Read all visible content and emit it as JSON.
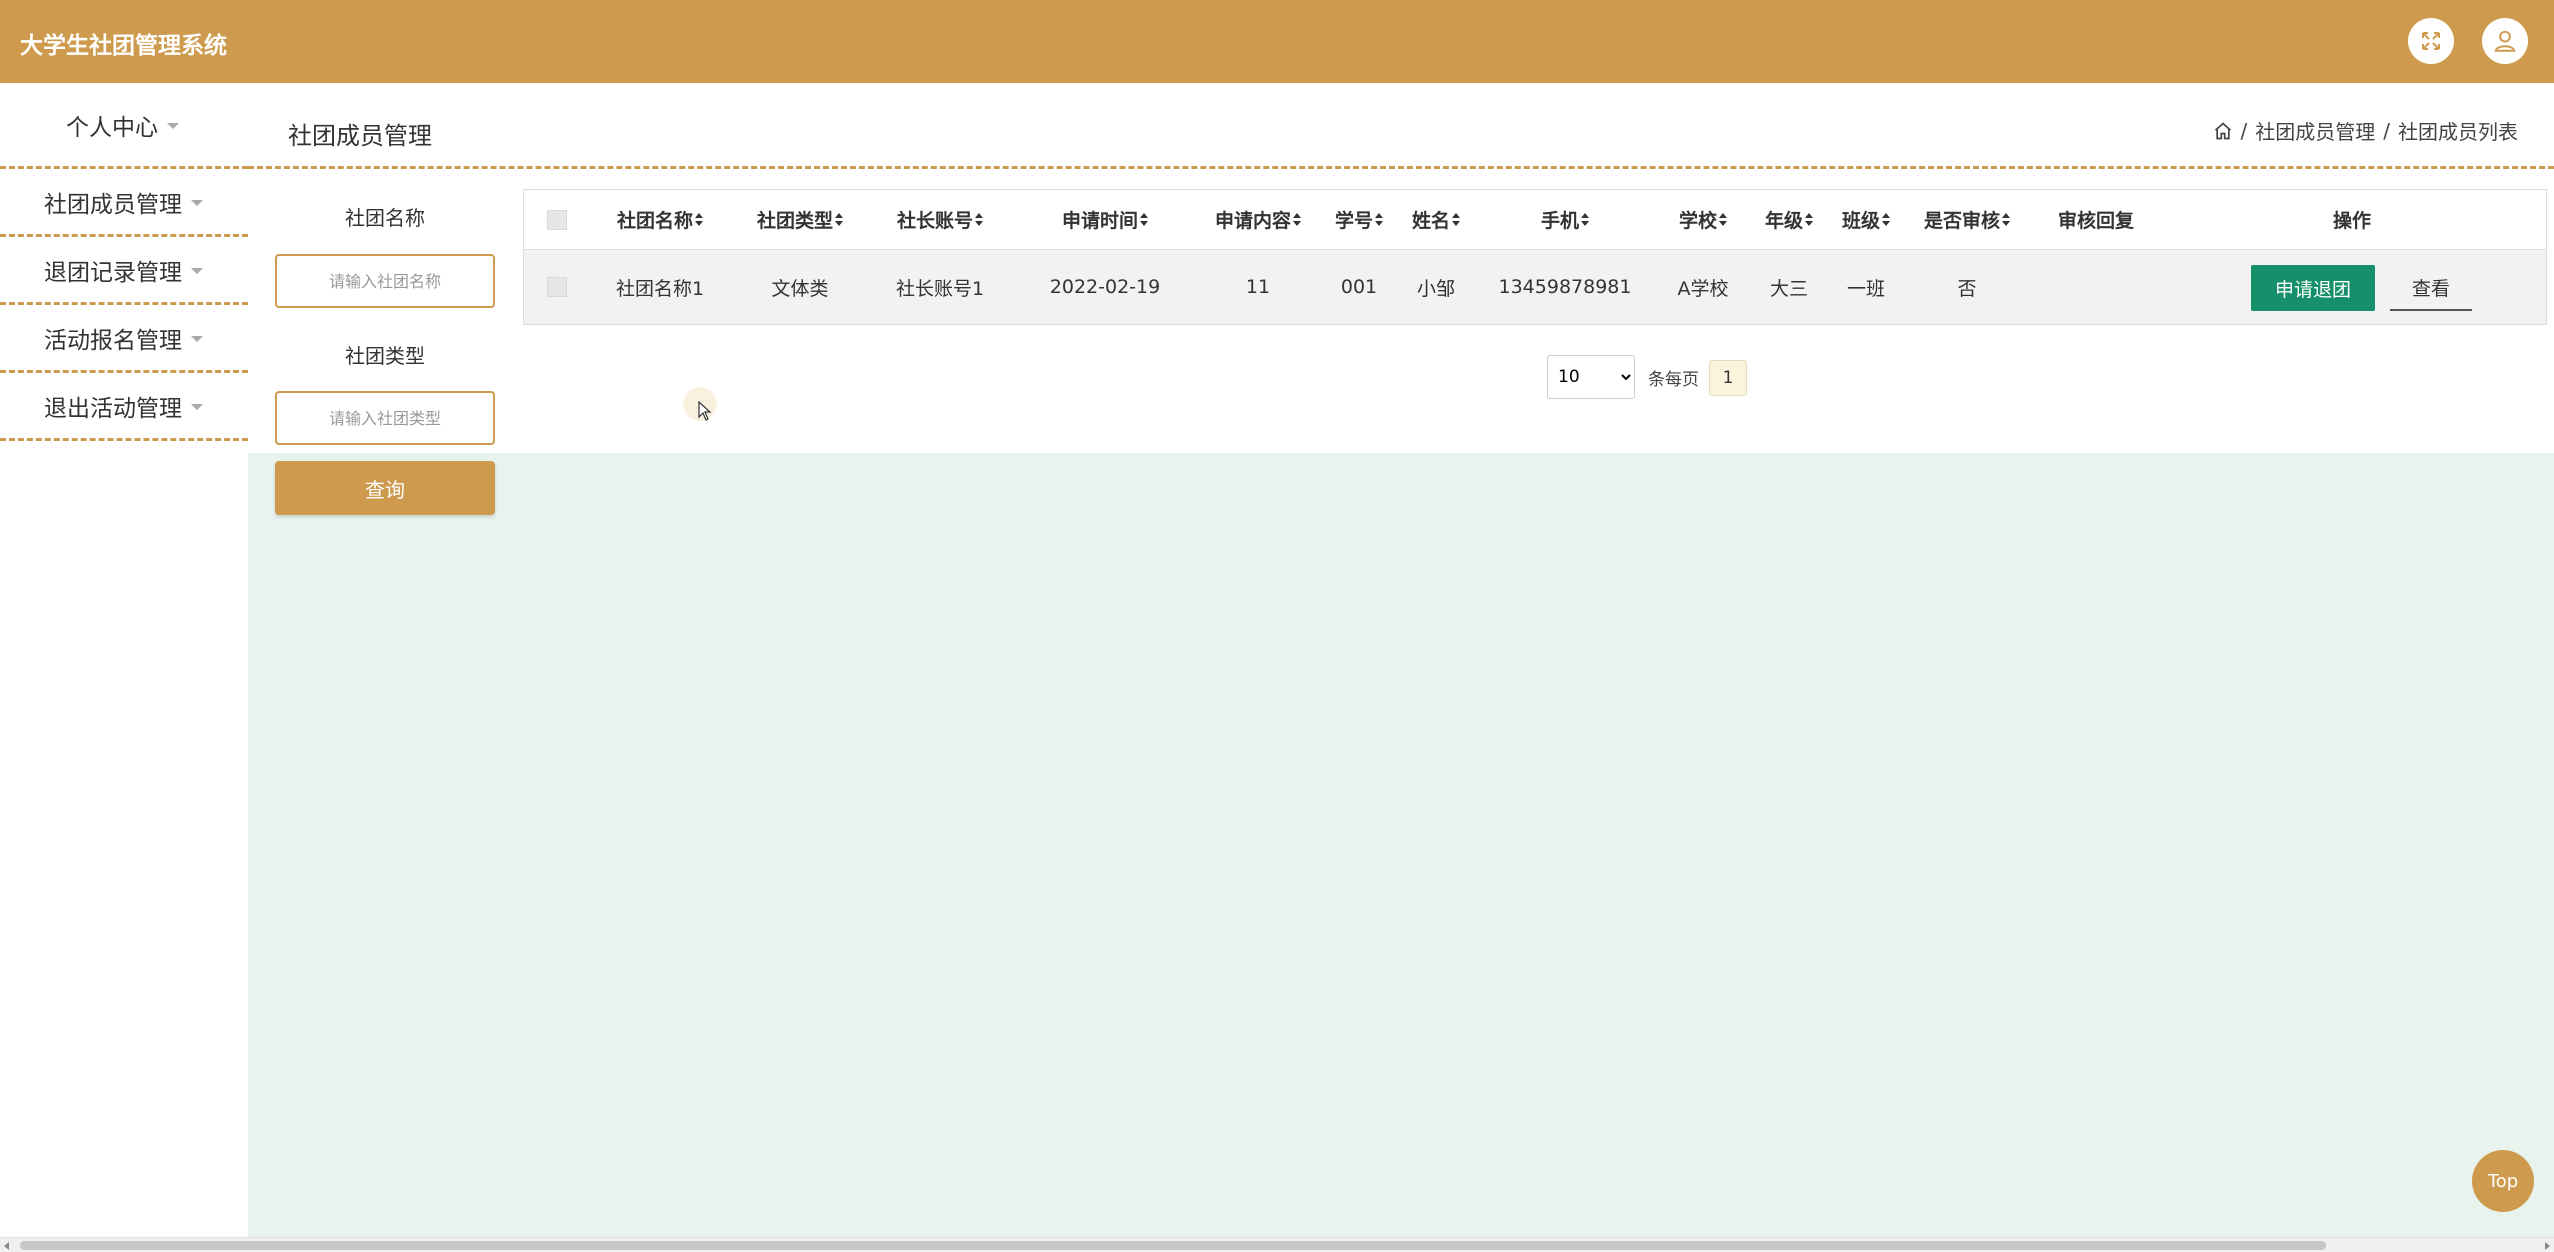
{
  "app": {
    "title": "大学生社团管理系统"
  },
  "header": {
    "fullscreen_icon": "fullscreen-icon",
    "user_icon": "user-icon"
  },
  "sidebar": {
    "items": [
      {
        "label": "个人中心"
      },
      {
        "label": "社团成员管理"
      },
      {
        "label": "退团记录管理"
      },
      {
        "label": "活动报名管理"
      },
      {
        "label": "退出活动管理"
      }
    ]
  },
  "page": {
    "title": "社团成员管理",
    "breadcrumb": [
      "社团成员管理",
      "社团成员列表"
    ]
  },
  "search": {
    "name_label": "社团名称",
    "name_placeholder": "请输入社团名称",
    "type_label": "社团类型",
    "type_placeholder": "请输入社团类型",
    "button": "查询"
  },
  "table": {
    "columns": [
      "社团名称",
      "社团类型",
      "社长账号",
      "申请时间",
      "申请内容",
      "学号",
      "姓名",
      "手机",
      "学校",
      "年级",
      "班级",
      "是否审核",
      "审核回复",
      "操作"
    ],
    "rows": [
      {
        "club_name": "社团名称1",
        "club_type": "文体类",
        "leader_account": "社长账号1",
        "apply_time": "2022-02-19",
        "apply_content": "11",
        "student_id": "001",
        "name": "小邹",
        "phone": "13459878981",
        "school": "A学校",
        "grade": "大三",
        "class": "一班",
        "reviewed": "否",
        "review_reply": "",
        "actions": {
          "apply_quit": "申请退团",
          "view": "查看"
        }
      }
    ]
  },
  "pagination": {
    "page_size": "10",
    "page_size_options": [
      "10"
    ],
    "per_page_label": "条每页",
    "current_page": "1"
  },
  "top_button": "Top",
  "colors": {
    "primary": "#CE9B4E",
    "action_green": "#16906A",
    "content_bg": "#E8F3EE"
  }
}
